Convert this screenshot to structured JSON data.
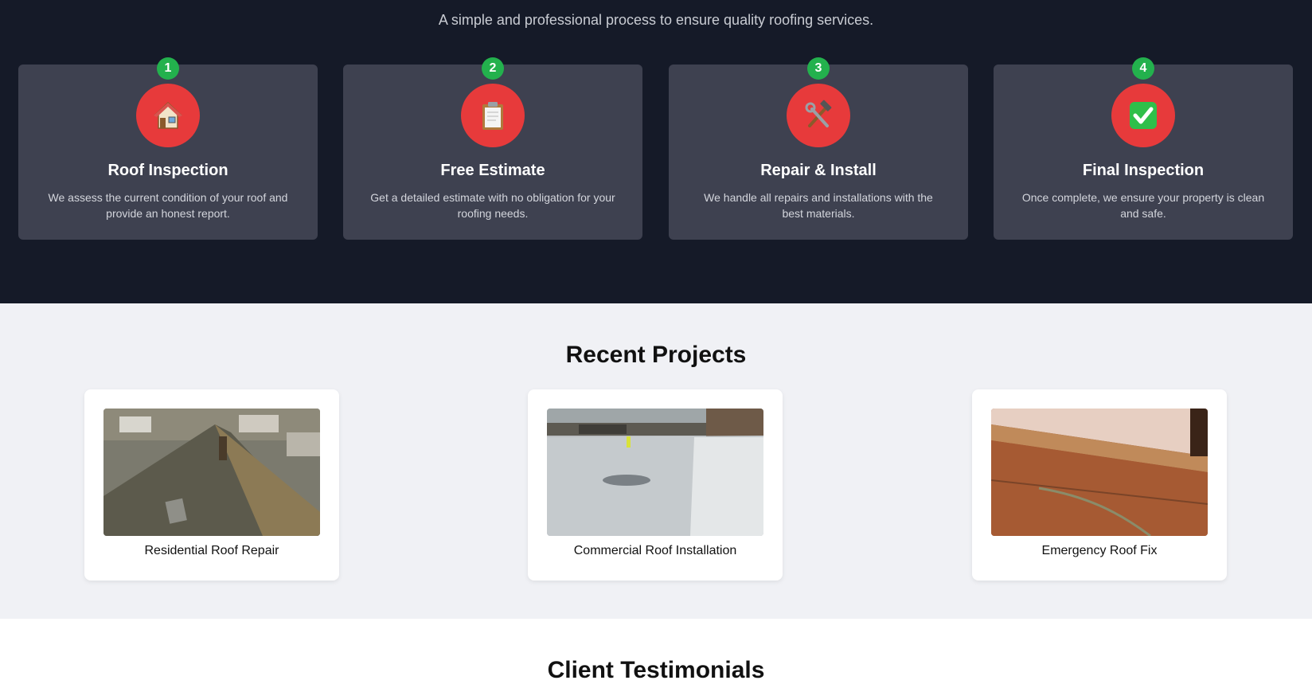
{
  "process": {
    "subtitle": "A simple and professional process to ensure quality roofing services.",
    "steps": [
      {
        "number": "1",
        "icon": "house-icon",
        "title": "Roof Inspection",
        "desc": "We assess the current condition of your roof and provide an honest report."
      },
      {
        "number": "2",
        "icon": "clipboard-icon",
        "title": "Free Estimate",
        "desc": "Get a detailed estimate with no obligation for your roofing needs."
      },
      {
        "number": "3",
        "icon": "hammer-wrench-icon",
        "title": "Repair & Install",
        "desc": "We handle all repairs and installations with the best materials."
      },
      {
        "number": "4",
        "icon": "check-mark-icon",
        "title": "Final Inspection",
        "desc": "Once complete, we ensure your property is clean and safe."
      }
    ],
    "colors": {
      "background": "#151a28",
      "card": "#3e4150",
      "badge": "#23b14d",
      "icon_circle": "#e73a3b"
    }
  },
  "projects": {
    "title": "Recent Projects",
    "items": [
      {
        "label": "Residential Roof Repair"
      },
      {
        "label": "Commercial Roof Installation"
      },
      {
        "label": "Emergency Roof Fix"
      }
    ]
  },
  "testimonials": {
    "title": "Client Testimonials"
  }
}
